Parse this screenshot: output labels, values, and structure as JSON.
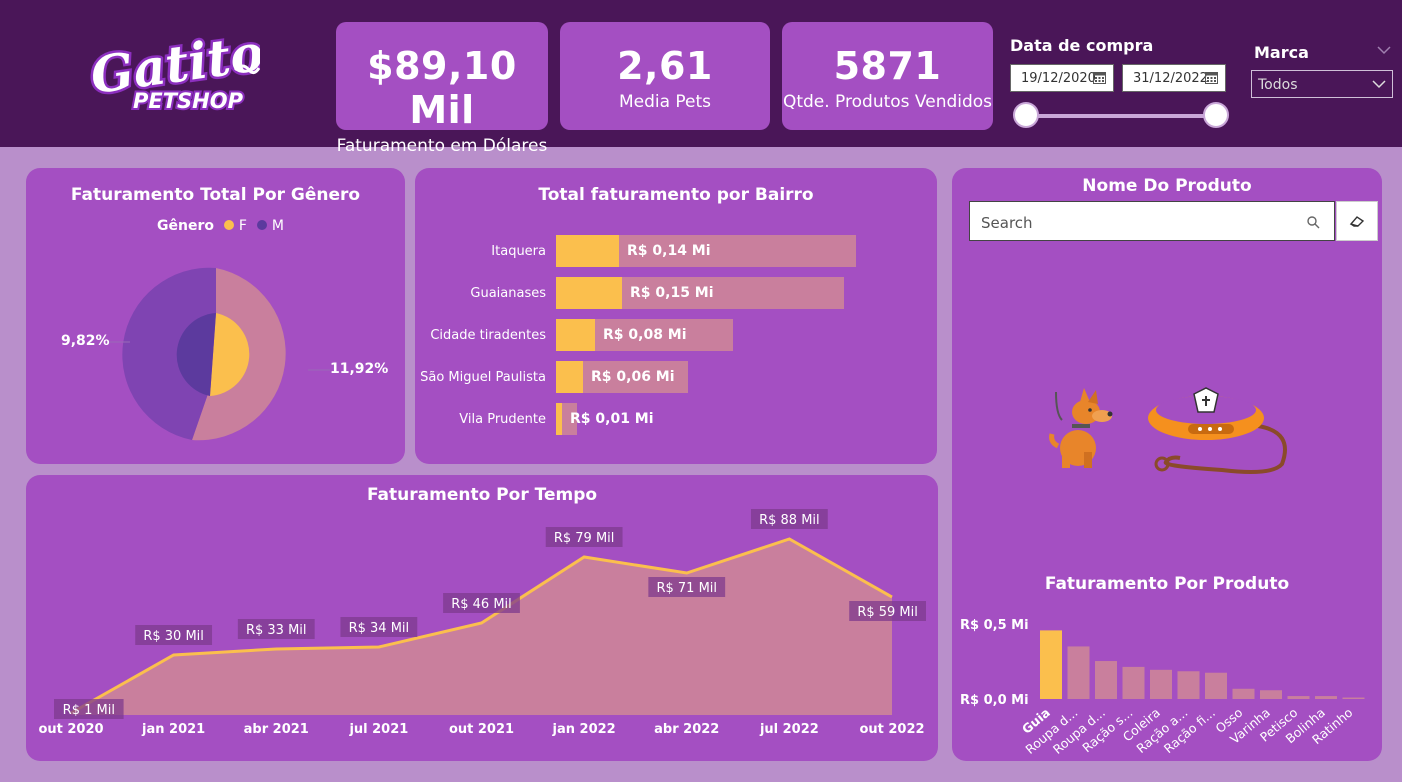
{
  "header": {
    "logo_text_1": "Gatito",
    "logo_text_2": "PETSHOP",
    "kpis": [
      {
        "value": "$89,10 Mil",
        "label": "Faturamento em Dólares"
      },
      {
        "value": "2,61",
        "label": "Media Pets"
      },
      {
        "value": "5871",
        "label": "Qtde. Produtos Vendidos"
      }
    ],
    "date_filter": {
      "label": "Data de compra",
      "start": "19/12/2020",
      "end": "31/12/2022"
    },
    "brand_filter": {
      "label": "Marca",
      "value": "Todos"
    }
  },
  "colors": {
    "header": "#4a1658",
    "panel": "#a44fc2",
    "background": "#b98fcb",
    "female": "#fbbf4d",
    "male": "#5c3a9e",
    "pink": "#c97f9d"
  },
  "gender_chart": {
    "title": "Faturamento Total Por Gênero",
    "legend_title": "Gênero",
    "legend": [
      "F",
      "M"
    ],
    "label_left": "9,82%",
    "label_right": "11,92%"
  },
  "bairro_chart": {
    "title": "Total faturamento por Bairro",
    "rows": [
      {
        "label": "Itaquera",
        "value": "R$ 0,14 Mi",
        "total_frac": 1.0,
        "fill_frac": 0.21
      },
      {
        "label": "Guaianases",
        "value": "R$ 0,15 Mi",
        "total_frac": 0.96,
        "fill_frac": 0.22
      },
      {
        "label": "Cidade tiradentes",
        "value": "R$ 0,08 Mi",
        "total_frac": 0.59,
        "fill_frac": 0.13
      },
      {
        "label": "São Miguel Paulista",
        "value": "R$ 0,06 Mi",
        "total_frac": 0.44,
        "fill_frac": 0.09
      },
      {
        "label": "Vila Prudente",
        "value": "R$ 0,01 Mi",
        "total_frac": 0.07,
        "fill_frac": 0.02
      }
    ]
  },
  "product_filter": {
    "title": "Nome Do Produto",
    "search_placeholder": "Search"
  },
  "chart_data": [
    {
      "type": "area",
      "title": "Faturamento Por Tempo",
      "x_ticks": [
        "out 2020",
        "jan 2021",
        "abr 2021",
        "jul 2021",
        "out 2021",
        "jan 2022",
        "abr 2022",
        "jul 2022",
        "out 2022"
      ],
      "x": [
        0,
        1,
        2,
        3,
        4,
        5,
        6,
        7,
        8
      ],
      "values": [
        1,
        30,
        33,
        34,
        46,
        79,
        71,
        88,
        59
      ],
      "data_labels": [
        "R$ 1 Mil",
        "R$ 30 Mil",
        "R$ 33 Mil",
        "R$ 34 Mil",
        "R$ 46 Mil",
        "R$ 79 Mil",
        "R$ 71 Mil",
        "R$ 88 Mil",
        "R$ 59 Mil"
      ],
      "ylim": [
        0,
        90
      ]
    },
    {
      "type": "bar",
      "title": "Faturamento Por Produto",
      "categories": [
        "Guia",
        "Roupa d...",
        "Roupa d...",
        "Ração s...",
        "Coleira",
        "Ração a...",
        "Ração fi...",
        "Osso",
        "Varinha",
        "Petisco",
        "Bolinha",
        "Ratinho"
      ],
      "values": [
        0.47,
        0.36,
        0.26,
        0.22,
        0.2,
        0.19,
        0.18,
        0.07,
        0.06,
        0.02,
        0.02,
        0.01
      ],
      "y_ticks": [
        "R$ 0,5 Mi",
        "R$ 0,0 Mi"
      ],
      "ylim": [
        0,
        0.5
      ],
      "highlight": "Guia"
    }
  ]
}
